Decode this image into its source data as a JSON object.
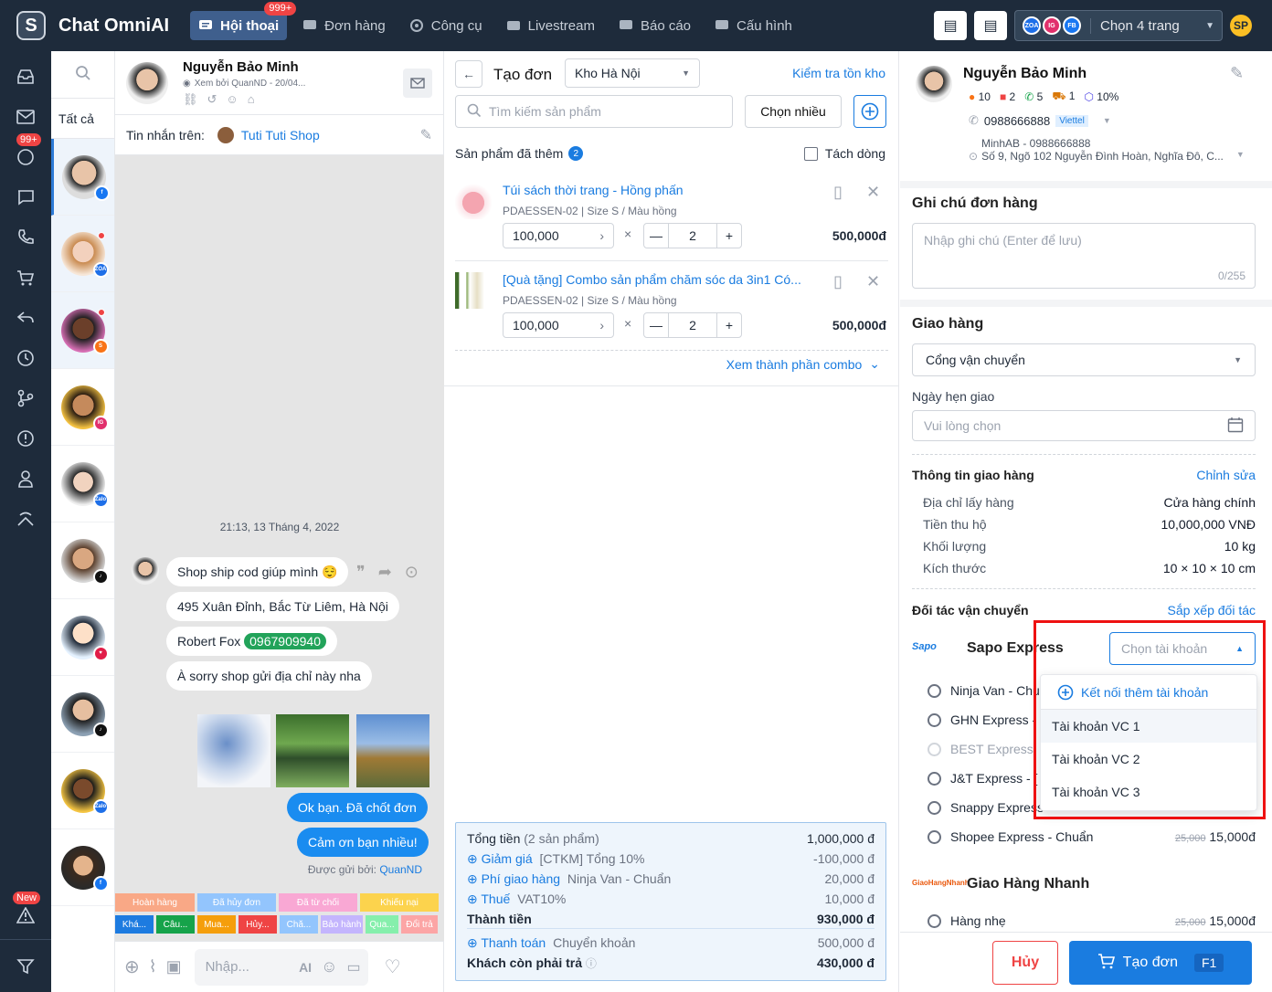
{
  "app": {
    "title": "Chat OmniAI",
    "logo_letter": "S"
  },
  "nav": [
    {
      "label": "Hội thoại",
      "badge": "999+",
      "active": true
    },
    {
      "label": "Đơn hàng"
    },
    {
      "label": "Công cụ"
    },
    {
      "label": "Livestream"
    },
    {
      "label": "Báo cáo"
    },
    {
      "label": "Cấu hình"
    }
  ],
  "page_select": {
    "label": "Chọn 4 trang",
    "platforms": [
      "ZOA",
      "IG",
      "FB"
    ]
  },
  "user_avatar": "SP",
  "leftbar": {
    "badge_messenger": "99+",
    "badge_new": "New"
  },
  "conv_list": {
    "filter_label": "Tất cả"
  },
  "chat": {
    "customer_name": "Nguyễn Bảo Minh",
    "seen_by": "Xem bởi QuanND - 20/04...",
    "source_label": "Tin nhắn trên:",
    "source_page": "Tuti Tuti Shop",
    "timestamp": "21:13, 13 Tháng 4, 2022",
    "messages": [
      "Shop ship cod giúp mình 😌",
      "495 Xuân Đỉnh, Bắc Từ Liêm, Hà Nội",
      "Robert Fox",
      "À sorry shop gửi địa chỉ này nha"
    ],
    "phone_tag": "0967909940",
    "replies": [
      "Ok bạn. Đã chốt đơn",
      "Cảm ơn bạn nhiều!"
    ],
    "sent_by_label": "Được gửi bởi:",
    "sent_by": "QuanND",
    "status_tags": [
      "Hoàn hàng",
      "Đã hủy đơn",
      "Đã từ chối",
      "Khiếu nại"
    ],
    "tags": [
      "Khá...",
      "Câu...",
      "Mua...",
      "Hủy...",
      "Chă...",
      "Bảo hành",
      "Qua...",
      "Đổi trả"
    ],
    "input_placeholder": "Nhập..."
  },
  "order": {
    "title": "Tạo đơn",
    "warehouse": "Kho Hà Nội",
    "check_stock": "Kiểm tra tồn kho",
    "search_placeholder": "Tìm kiếm sản phẩm",
    "choose_many": "Chọn nhiều",
    "added_label": "Sản phẩm đã thêm",
    "added_count": "2",
    "split_label": "Tách dòng",
    "products": [
      {
        "name": "Túi sách thời trang - Hồng phấn",
        "variant": "PDAESSEN-02 | Size S / Màu hồng",
        "price": "100,000",
        "qty": "2",
        "total": "500,000đ"
      },
      {
        "name": "[Quà tặng] Combo sản phẩm chăm sóc da 3in1 Có...",
        "variant": "PDAESSEN-02 | Size S / Màu hồng",
        "price": "100,000",
        "qty": "2",
        "total": "500,000đ"
      }
    ],
    "combo_link": "Xem thành phần combo",
    "summary": {
      "total_label": "Tổng tiền",
      "total_note": "(2 sản phẩm)",
      "total": "1,000,000 đ",
      "discount_label": "Giảm giá",
      "discount_note": "[CTKM] Tổng 10%",
      "discount": "-100,000 đ",
      "ship_label": "Phí giao hàng",
      "ship_note": "Ninja Van - Chuẩn",
      "ship": "20,000 đ",
      "tax_label": "Thuế",
      "tax_note": "VAT10%",
      "tax": "10,000 đ",
      "subtotal_label": "Thành tiền",
      "subtotal": "930,000 đ",
      "pay_label": "Thanh toán",
      "pay_note": "Chuyển khoản",
      "pay": "500,000 đ",
      "due_label": "Khách còn phải trả",
      "due": "430,000 đ"
    }
  },
  "customer": {
    "name": "Nguyễn Bảo Minh",
    "stats": [
      "10",
      "2",
      "5",
      "1",
      "10%"
    ],
    "phone": "0988666888",
    "carrier": "Viettel",
    "address_name": "MinhAB - 0988666888",
    "address": "Số 9, Ngõ 102 Nguyễn Đình Hoàn, Nghĩa Đô, C..."
  },
  "note": {
    "title": "Ghi chú đơn hàng",
    "placeholder": "Nhập ghi chú (Enter để lưu)",
    "counter": "0/255"
  },
  "delivery": {
    "title": "Giao hàng",
    "method": "Cổng vận chuyển",
    "date_label": "Ngày hẹn giao",
    "date_placeholder": "Vui lòng chọn",
    "info_title": "Thông tin giao hàng",
    "edit": "Chỉnh sửa",
    "info": [
      {
        "k": "Địa chỉ lấy hàng",
        "v": "Cửa hàng chính"
      },
      {
        "k": "Tiền thu hộ",
        "v": "10,000,000 VNĐ"
      },
      {
        "k": "Khối lượng",
        "v": "10 kg"
      },
      {
        "k": "Kích thước",
        "v": "10 × 10 × 10 cm"
      }
    ],
    "partner_title": "Đối tác vận chuyển",
    "sort_partners": "Sắp xếp đối tác",
    "sapo_logo": "Sapo",
    "sapo_name": "Sapo Express",
    "account_placeholder": "Chọn tài khoản",
    "carriers": [
      "Ninja Van - Chu",
      "GHN Express -",
      "BEST Express",
      "J&T Express - [",
      "Snappy Express",
      "Shopee Express - Chuẩn"
    ],
    "shopee_old": "25,000",
    "shopee_new": "15,000đ",
    "ghn_logo": "GiaoHangNhanh",
    "ghn_name": "Giao Hàng Nhanh",
    "ghn_item": "Hàng nhẹ",
    "ghn_old": "25,000",
    "ghn_new": "15,000đ"
  },
  "account_dropdown": {
    "connect": "Kết nối thêm tài khoản",
    "items": [
      "Tài khoản VC 1",
      "Tài khoản VC 2",
      "Tài khoản VC 3"
    ]
  },
  "actions": {
    "cancel": "Hủy",
    "create": "Tạo đơn",
    "shortcut": "F1"
  }
}
